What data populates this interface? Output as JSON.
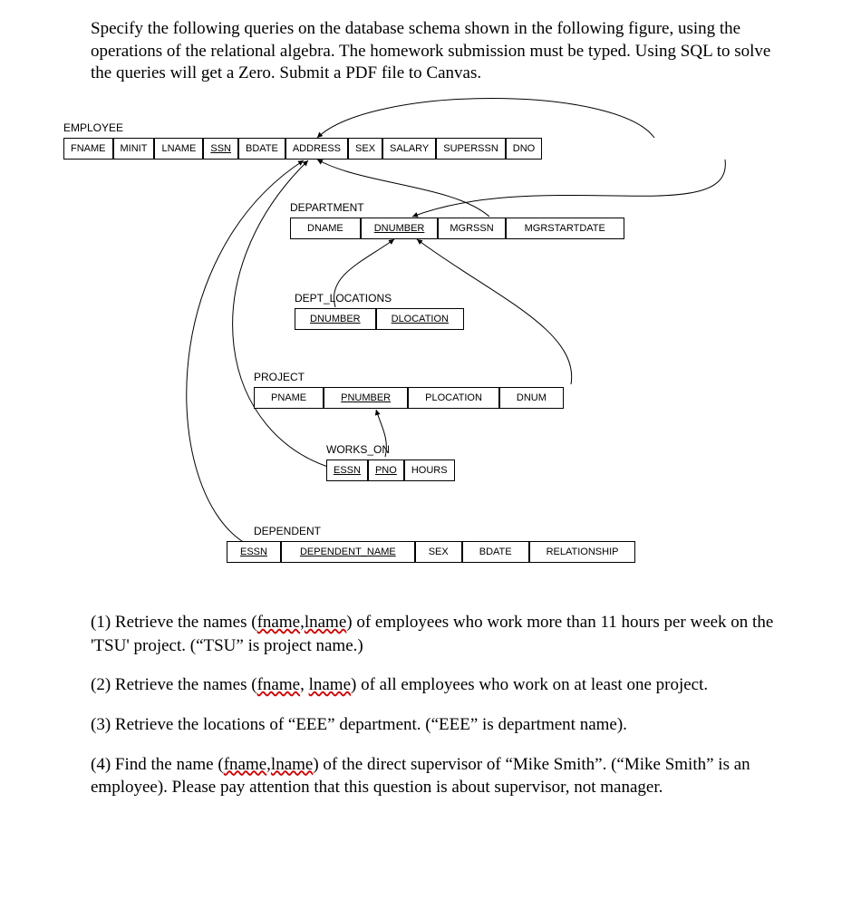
{
  "intro": "Specify the following queries on the database schema shown in the following figure, using the operations of the relational algebra. The homework submission must be typed. Using SQL to solve the queries will get a Zero.  Submit a PDF file to Canvas.",
  "tables": {
    "employee": {
      "name": "EMPLOYEE",
      "cols": [
        "FNAME",
        "MINIT",
        "LNAME",
        "SSN",
        "BDATE",
        "ADDRESS",
        "SEX",
        "SALARY",
        "SUPERSSN",
        "DNO"
      ],
      "keys": [
        "SSN"
      ]
    },
    "department": {
      "name": "DEPARTMENT",
      "cols": [
        "DNAME",
        "DNUMBER",
        "MGRSSN",
        "MGRSTARTDATE"
      ],
      "keys": [
        "DNUMBER"
      ]
    },
    "dept_locations": {
      "name": "DEPT_LOCATIONS",
      "cols": [
        "DNUMBER",
        "DLOCATION"
      ],
      "keys": [
        "DNUMBER",
        "DLOCATION"
      ]
    },
    "project": {
      "name": "PROJECT",
      "cols": [
        "PNAME",
        "PNUMBER",
        "PLOCATION",
        "DNUM"
      ],
      "keys": [
        "PNUMBER"
      ]
    },
    "works_on": {
      "name": "WORKS_ON",
      "cols": [
        "ESSN",
        "PNO",
        "HOURS"
      ],
      "keys": [
        "ESSN",
        "PNO"
      ]
    },
    "dependent": {
      "name": "DEPENDENT",
      "cols": [
        "ESSN",
        "DEPENDENT_NAME",
        "SEX",
        "BDATE",
        "RELATIONSHIP"
      ],
      "keys": [
        "ESSN",
        "DEPENDENT_NAME"
      ]
    }
  },
  "relationships": [
    {
      "from": "EMPLOYEE.SUPERSSN",
      "to": "EMPLOYEE.SSN"
    },
    {
      "from": "EMPLOYEE.DNO",
      "to": "DEPARTMENT.DNUMBER"
    },
    {
      "from": "DEPARTMENT.MGRSSN",
      "to": "EMPLOYEE.SSN"
    },
    {
      "from": "DEPT_LOCATIONS.DNUMBER",
      "to": "DEPARTMENT.DNUMBER"
    },
    {
      "from": "PROJECT.DNUM",
      "to": "DEPARTMENT.DNUMBER"
    },
    {
      "from": "WORKS_ON.ESSN",
      "to": "EMPLOYEE.SSN"
    },
    {
      "from": "WORKS_ON.PNO",
      "to": "PROJECT.PNUMBER"
    },
    {
      "from": "DEPENDENT.ESSN",
      "to": "EMPLOYEE.SSN"
    }
  ],
  "questions": {
    "q1_a": "(1) Retrieve the names (",
    "q1_sq1": "fname",
    "q1_mid1": ",",
    "q1_sq2": "lname",
    "q1_b": ") of employees who work more than 11 hours per week on the 'TSU' project. (“TSU” is project name.)",
    "q2_a": "(2) Retrieve the names (",
    "q2_sq1": "fname",
    "q2_mid": ", ",
    "q2_sq2": "lname",
    "q2_b": ") of all employees who work on at least one project.",
    "q3": "(3) Retrieve the locations of “EEE” department.  (“EEE” is department name).",
    "q4_a": "(4) Find the name (",
    "q4_sq1": "fname",
    "q4_mid": ",",
    "q4_sq2": "lname",
    "q4_b": ") of the direct supervisor of “Mike Smith”.  (“Mike Smith” is an employee).  Please pay attention that this question is about supervisor, not manager."
  }
}
